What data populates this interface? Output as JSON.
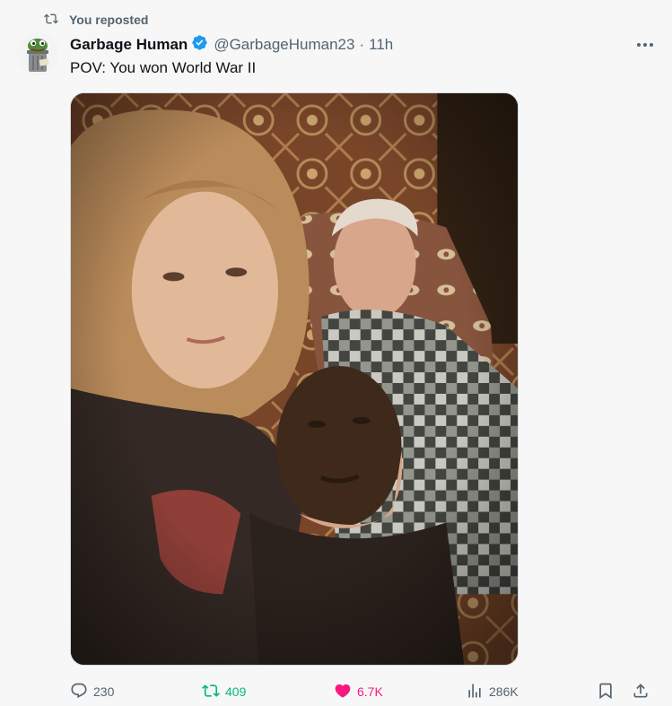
{
  "repost_banner": {
    "text": "You reposted"
  },
  "author": {
    "name": "Garbage Human",
    "handle": "@GarbageHuman23",
    "separator": "·",
    "time": "11h",
    "avatar_icon": "pepe-trashcan-avatar",
    "verified_color": "#1d9bf0"
  },
  "tweet": {
    "text": "POV: You won World War II",
    "media_description_icon": "photo"
  },
  "actions": {
    "replies": "230",
    "reposts": "409",
    "likes": "6.7K",
    "views": "286K"
  },
  "colors": {
    "repost_active": "#00ba7c",
    "like_active": "#f91880",
    "muted": "#536471"
  }
}
